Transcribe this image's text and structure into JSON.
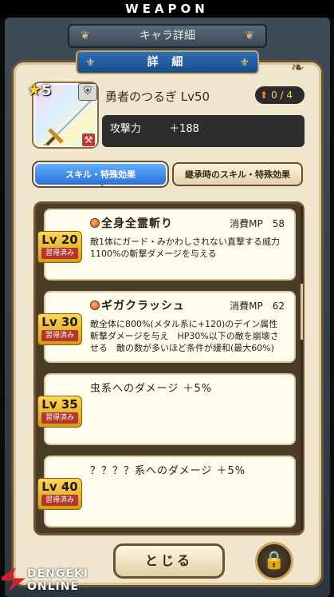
{
  "banner": {
    "title": "WEAPON"
  },
  "header": {
    "title": "キャラ詳細"
  },
  "panel": {
    "title": "詳 細"
  },
  "weapon": {
    "stars": "5",
    "name": "勇者のつるぎ Lv50",
    "upgrade": "0 / 4",
    "stat_label": "攻撃力",
    "stat_value": "＋188"
  },
  "tabs": {
    "active": "スキル・特殊効果",
    "inactive": "継承時のスキル・特殊効果"
  },
  "skills": [
    {
      "level": "Lv 20",
      "learned": "習得済み",
      "name": "全身全霊斬り",
      "mp": "消費MP　58",
      "desc": "敵1体にガード・みかわしされない直撃する威力\n1100%の斬撃ダメージを与える",
      "has_orb": true
    },
    {
      "level": "Lv 30",
      "learned": "習得済み",
      "name": "ギガクラッシュ",
      "mp": "消費MP　62",
      "desc": "敵全体に800%(メタル系に+120)のデイン属性\n斬撃ダメージを与え　HP30%以下の敵を崩壊さ\nせる　敵の数が多いほど条件が緩和(最大60%)",
      "has_orb": true
    },
    {
      "level": "Lv 35",
      "learned": "習得済み",
      "name": "虫系へのダメージ ＋5%",
      "mp": "",
      "desc": "",
      "has_orb": false
    },
    {
      "level": "Lv 40",
      "learned": "習得済み",
      "name": "？？？？系へのダメージ ＋5%",
      "mp": "",
      "desc": "",
      "has_orb": false
    }
  ],
  "footer": {
    "close_label": "とじる"
  },
  "watermark": {
    "line1": "DENGEKI",
    "line2": "ONLINE"
  }
}
